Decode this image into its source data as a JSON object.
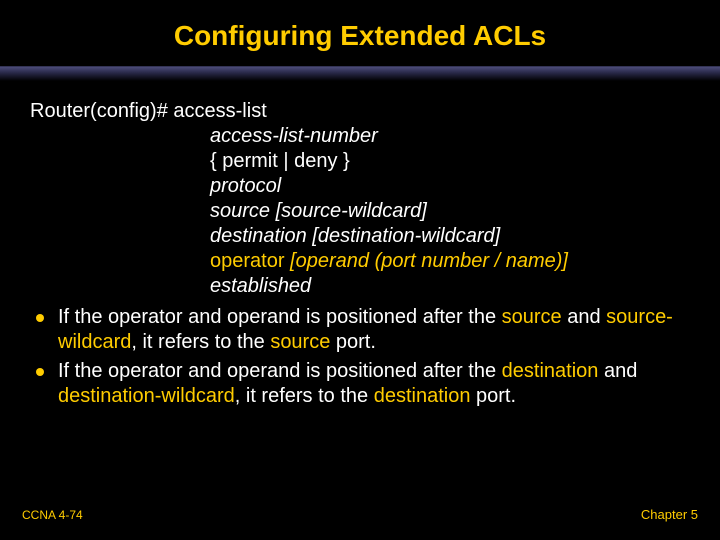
{
  "title": "Configuring Extended ACLs",
  "cmd": {
    "prefix": "Router(config)# access-list",
    "lines": [
      "access-list-number",
      "{ permit | deny }",
      "protocol",
      "source [source-wildcard]",
      "destination [destination-wildcard]",
      "operator [operand (port number / name)]",
      "established"
    ],
    "operator_word": "operator",
    "operand_rest": " [operand (port number / name)]"
  },
  "bullets": [
    {
      "pre1": "If the operator and operand is positioned after the ",
      "g1": "source",
      "mid1": " and ",
      "g2": "source-wildcard",
      "mid2": ", it refers to the ",
      "g3": "source",
      "post": " port."
    },
    {
      "pre1": "If the operator and operand is positioned after the ",
      "g1": "destination",
      "mid1": " and ",
      "g2": "destination-wildcard",
      "mid2": ", it refers to the ",
      "g3": "destination",
      "post": " port."
    }
  ],
  "footer": {
    "left": "CCNA 4-74",
    "right": "Chapter 5"
  }
}
